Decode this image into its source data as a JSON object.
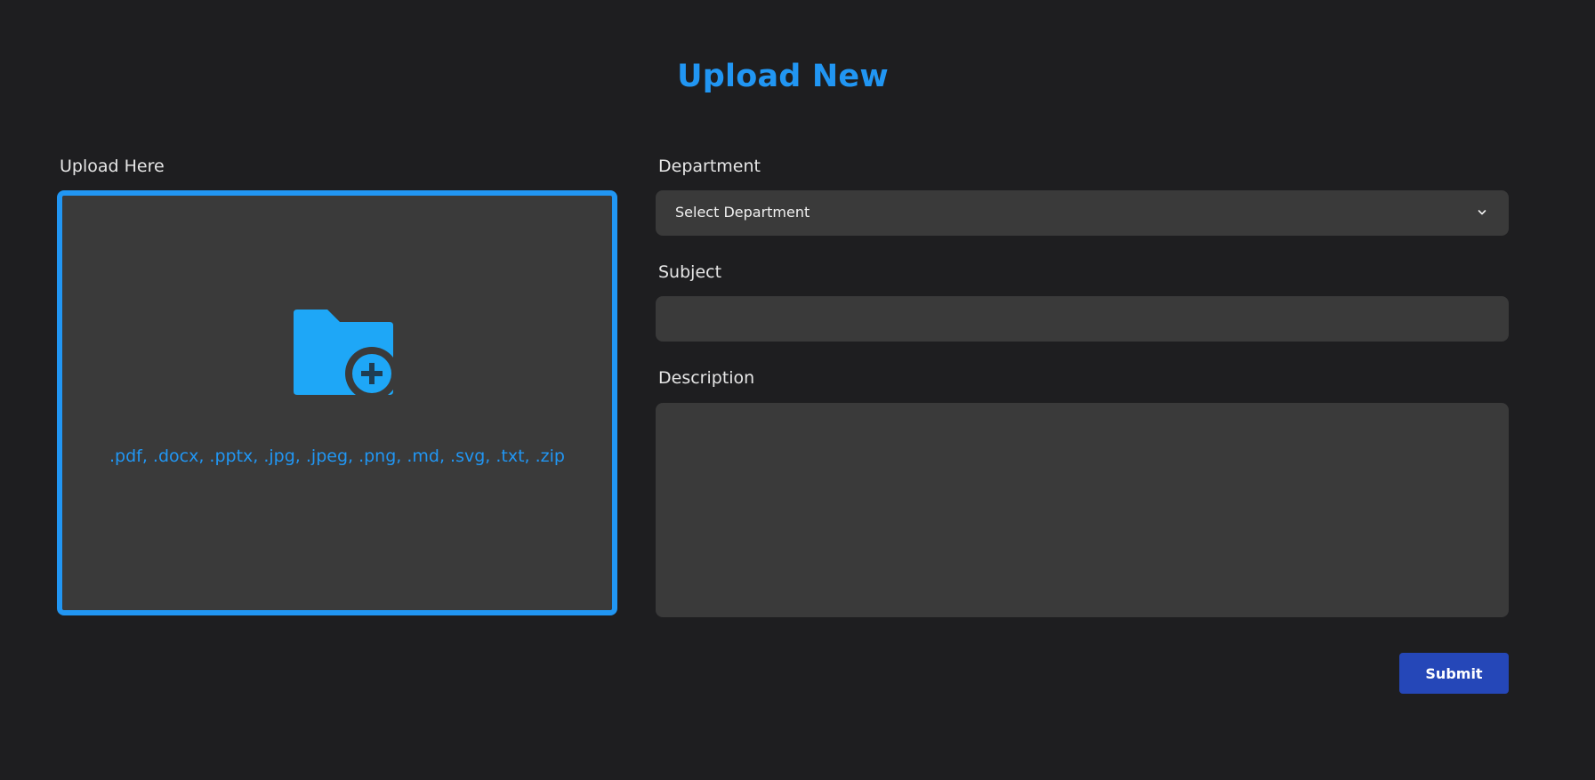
{
  "header": {
    "title": "Upload New"
  },
  "upload": {
    "label": "Upload Here",
    "accepted_types": ".pdf, .docx, .pptx, .jpg, .jpeg, .png, .md, .svg, .txt, .zip",
    "icon": "folder-add-icon"
  },
  "form": {
    "department": {
      "label": "Department",
      "selected": "Select Department",
      "icon": "chevron-down-icon"
    },
    "subject": {
      "label": "Subject",
      "value": ""
    },
    "description": {
      "label": "Description",
      "value": ""
    },
    "submit_label": "Submit"
  },
  "colors": {
    "background": "#1e1e20",
    "field_background": "#3a3a3a",
    "accent": "#2196f3",
    "button": "#2547b8",
    "label_text": "#e6e6e6"
  }
}
